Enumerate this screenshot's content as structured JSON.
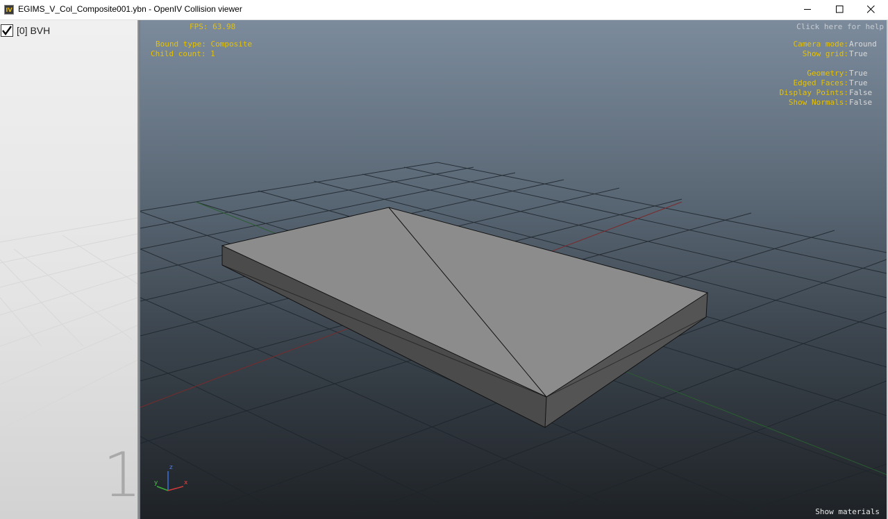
{
  "window": {
    "title": "EGIMS_V_Col_Composite001.ybn - OpenIV Collision viewer",
    "icon": "openiv-app-icon",
    "icon_text": "IV"
  },
  "sidebar": {
    "items": [
      {
        "label": "[0] BVH",
        "checked": true
      }
    ],
    "page_number": "1"
  },
  "hud": {
    "fps_label": "FPS:",
    "fps_value": "63.98",
    "bound_type_label": "Bound type:",
    "bound_type_value": "Composite",
    "child_count_label": "Child count:",
    "child_count_value": "1",
    "help_text": "Click here for help",
    "camera_mode_label": "Camera mode:",
    "camera_mode_value": "Around",
    "show_grid_label": "Show grid:",
    "show_grid_value": "True",
    "geometry_label": "Geometry:",
    "geometry_value": "True",
    "edged_faces_label": "Edged Faces:",
    "edged_faces_value": "True",
    "display_points_label": "Display Points:",
    "display_points_value": "False",
    "show_normals_label": "Show Normals:",
    "show_normals_value": "False"
  },
  "axes": {
    "z": "z",
    "y": "y",
    "x": "x"
  },
  "footer": {
    "show_materials": "Show materials"
  },
  "colors": {
    "hud_label": "#e6c200",
    "hud_value": "#d9d9d9",
    "box_top": "#8b8b8b",
    "box_side": "#4a4a4a",
    "grid_line": "#1b2127",
    "axis_x": "#8a2f2f",
    "axis_z": "#2d6b35"
  }
}
